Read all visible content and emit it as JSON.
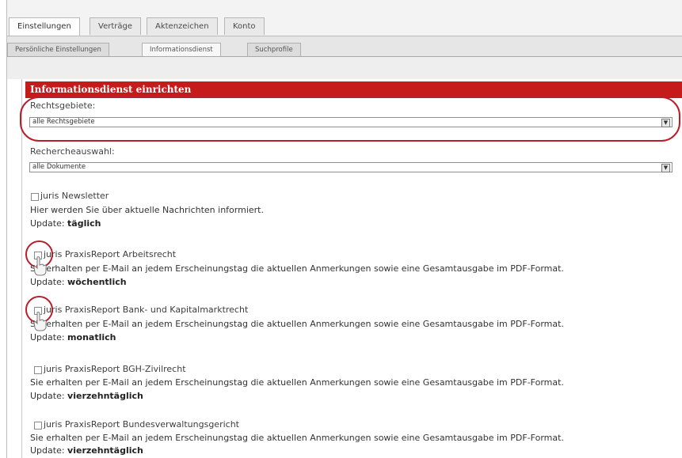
{
  "tabs_top": [
    "Einstellungen",
    "Verträge",
    "Aktenzeichen",
    "Konto"
  ],
  "tabs_sub": [
    "Persönliche Einstellungen",
    "Informationsdienst",
    "Suchprofile"
  ],
  "panel": {
    "title": "Informationsdienst einrichten",
    "field1_label": "Rechtsgebiete:",
    "field1_value": "alle Rechtsgebiete",
    "field2_label": "Rechercheauswahl:",
    "field2_value": "alle Dokumente"
  },
  "update_label": "Update:",
  "items": [
    {
      "title": "juris Newsletter",
      "desc": "Hier werden Sie über aktuelle Nachrichten informiert.",
      "update": "täglich"
    },
    {
      "title": "juris PraxisReport Arbeitsrecht",
      "desc": "Sie erhalten per E-Mail an jedem Erscheinungstag die aktuellen Anmerkungen sowie eine Gesamtausgabe im PDF-Format.",
      "update": "wöchentlich"
    },
    {
      "title": "juris PraxisReport Bank- und Kapitalmarktrecht",
      "desc": "Sie erhalten per E-Mail an jedem Erscheinungstag die aktuellen Anmerkungen sowie eine Gesamtausgabe im PDF-Format.",
      "update": "monatlich"
    },
    {
      "title": "juris PraxisReport BGH-Zivilrecht",
      "desc": "Sie erhalten per E-Mail an jedem Erscheinungstag die aktuellen Anmerkungen sowie eine Gesamtausgabe im PDF-Format.",
      "update": "vierzehntäglich"
    },
    {
      "title": "juris PraxisReport Bundesverwaltungsgericht",
      "desc": "Sie erhalten per E-Mail an jedem Erscheinungstag die aktuellen Anmerkungen sowie eine Gesamtausgabe im PDF-Format.",
      "update": "vierzehntäglich"
    }
  ]
}
